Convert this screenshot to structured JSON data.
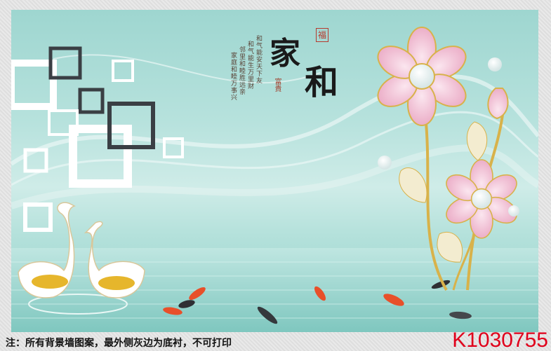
{
  "artwork": {
    "title_chars": [
      "家",
      "和"
    ],
    "small_seal_top": "福",
    "seal_fugui": "富貴",
    "poem_lines": [
      "和气能安天下友",
      "和气能生万里财",
      "邻里和睦胜远亲",
      "家庭和睦万事兴"
    ],
    "colors": {
      "teal": "#9ed6d0",
      "pink_petal": "#f2c2d6",
      "gold": "#d8b24a",
      "koi_orange": "#e8502a"
    }
  },
  "footer": {
    "note": "注：所有背景墙图案，最外侧灰边为底衬，不可打印",
    "product_code": "K1030755"
  }
}
